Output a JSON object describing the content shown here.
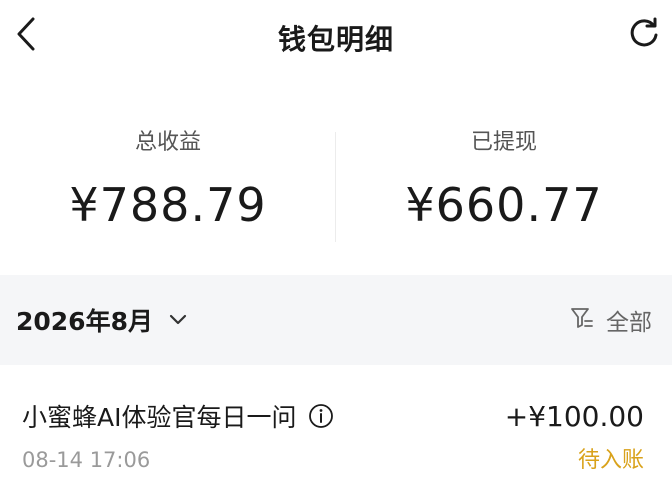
{
  "header": {
    "title": "钱包明细",
    "back_icon": "chevron-left-icon",
    "refresh_icon": "refresh-icon"
  },
  "summary": {
    "total_income_label": "总收益",
    "total_income_value": "¥788.79",
    "withdrawn_label": "已提现",
    "withdrawn_value": "¥660.77"
  },
  "filter": {
    "month": "2026年8月",
    "month_icon": "chevron-down-icon",
    "filter_icon": "filter-icon",
    "filter_label": "全部"
  },
  "transactions": [
    {
      "title": "小蜜蜂AI体验官每日一问",
      "info_icon": "info-icon",
      "time": "08-14 17:06",
      "amount": "+¥100.00",
      "status": "待入账"
    }
  ],
  "colors": {
    "filter_bar_bg": "#f5f6f8",
    "pending_status": "#d9a21b",
    "secondary_text": "#9a9a9a"
  }
}
